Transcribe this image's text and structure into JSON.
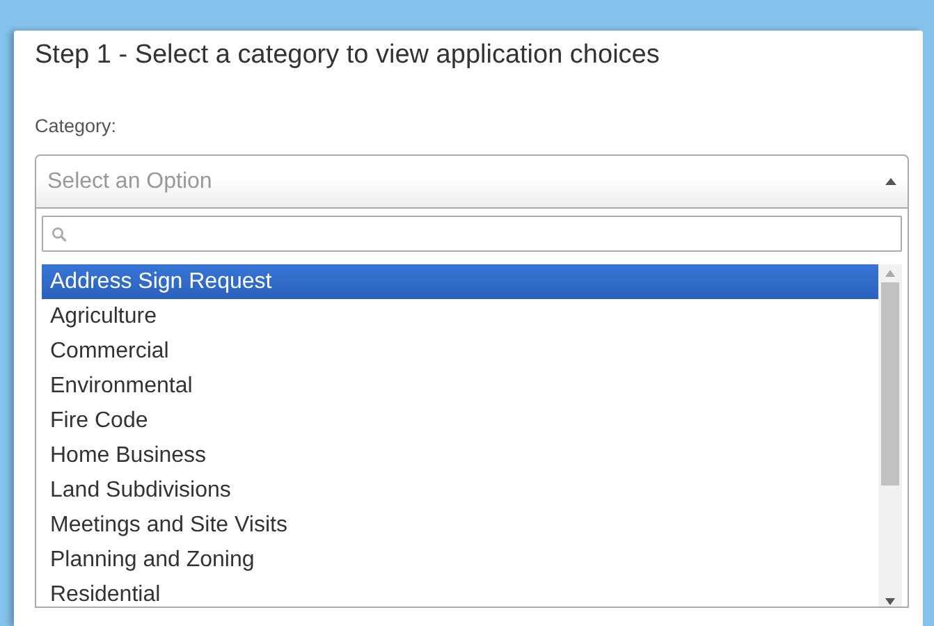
{
  "heading": "Step 1 - Select a category to view application choices",
  "category_label": "Category:",
  "select": {
    "placeholder": "Select an Option",
    "expanded": true
  },
  "options": [
    {
      "label": "Address Sign Request",
      "selected": true
    },
    {
      "label": "Agriculture",
      "selected": false
    },
    {
      "label": "Commercial",
      "selected": false
    },
    {
      "label": "Environmental",
      "selected": false
    },
    {
      "label": "Fire Code",
      "selected": false
    },
    {
      "label": "Home Business",
      "selected": false
    },
    {
      "label": "Land Subdivisions",
      "selected": false
    },
    {
      "label": "Meetings and Site Visits",
      "selected": false
    },
    {
      "label": "Planning and Zoning",
      "selected": false
    },
    {
      "label": "Residential",
      "selected": false
    }
  ]
}
